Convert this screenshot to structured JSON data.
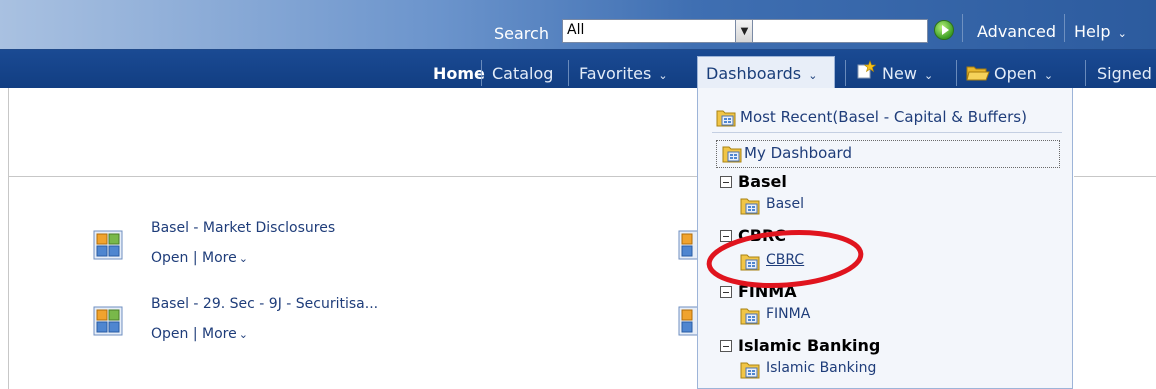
{
  "header": {
    "search_label": "Search",
    "search_scope": "All",
    "advanced_label": "Advanced",
    "help_label": "Help"
  },
  "nav": {
    "home": "Home",
    "catalog": "Catalog",
    "favorites": "Favorites",
    "dashboards": "Dashboards",
    "new": "New",
    "open": "Open",
    "signed": "Signed"
  },
  "dashboards_list": [
    {
      "title": "Basel - Market Disclosures",
      "open": "Open",
      "more": "More"
    },
    {
      "title": "Basel - 29. Sec - 9J - Securitisa...",
      "open": "Open",
      "more": "More"
    }
  ],
  "links_separator": "|",
  "dropdown": {
    "most_recent": "Most Recent(Basel - Capital & Buffers)",
    "my_dashboard": "My Dashboard",
    "groups": [
      {
        "name": "Basel",
        "item": "Basel"
      },
      {
        "name": "CBRC",
        "item": "CBRC"
      },
      {
        "name": "FINMA",
        "item": "FINMA"
      },
      {
        "name": "Islamic Banking",
        "item": "Islamic Banking"
      }
    ]
  },
  "colors": {
    "header_dark": "#123e82",
    "link_blue": "#1f3d7a",
    "highlight_red": "#e0141e"
  },
  "icons": {
    "dashboard": "dashboard-grid-icon",
    "go": "go-arrow-icon",
    "new": "new-star-icon",
    "open": "folder-icon",
    "collapse": "minus-box-icon",
    "chevron": "chevron-down-icon"
  }
}
